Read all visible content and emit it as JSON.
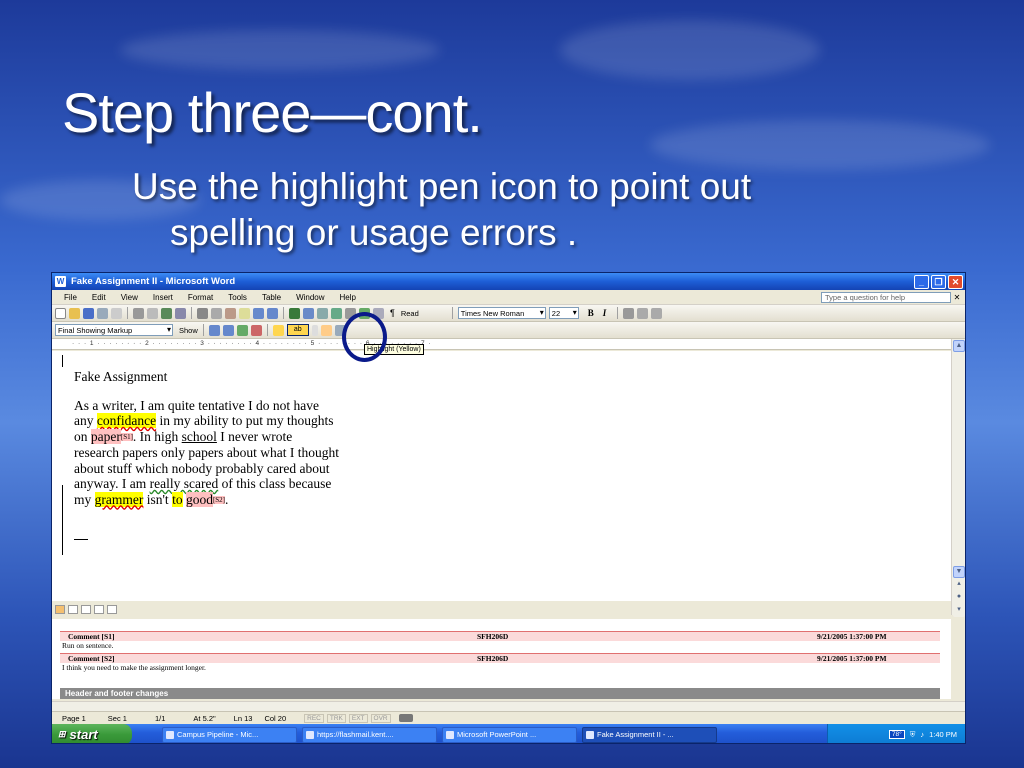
{
  "slide": {
    "title": "Step three—cont.",
    "bullet_line1": "Use the highlight pen icon to point out",
    "bullet_line2": "spelling or usage errors ."
  },
  "window": {
    "title": "Fake Assignment II - Microsoft Word",
    "menu": [
      "File",
      "Edit",
      "View",
      "Insert",
      "Format",
      "Tools",
      "Table",
      "Window",
      "Help"
    ],
    "help_placeholder": "Type a question for help"
  },
  "toolbar": {
    "read_label": "Read",
    "font": "Times New Roman",
    "font_size": "22"
  },
  "review_toolbar": {
    "markup_mode": "Final Showing Markup",
    "show_label": "Show",
    "highlight_tooltip": "Highlight (Yellow)"
  },
  "ruler": {
    "text": "· · · 1 · · · · · · · · 2 · · · · · · · · 3 · · · · · · · · 4 · · · · · · · · 5 · · · · · · · · 6 · · · · · · · · 7 ·"
  },
  "document": {
    "title": "Fake Assignment",
    "l1": "As a writer, I am quite tentative I do not have",
    "l2a": "any ",
    "l2_err": "confidance",
    "l2b": " in my ability to put my thoughts",
    "l3a": "on ",
    "l3_cmt": "paper",
    "l3_mark": "[S1]",
    "l3b": ".  In high ",
    "l3_school": "school",
    "l3c": " I never wrote",
    "l4": "research papers only papers about what I thought",
    "l5": "about stuff which nobody probably cared about",
    "l6a": "anyway.  I am ",
    "l6_really": "really scared",
    "l6b": " of this class because",
    "l7a": "my ",
    "l7_err": "grammer",
    "l7b": " isn't ",
    "l7_to": "to",
    "l7c": " ",
    "l7_good": "good",
    "l7_mark": "[S2]",
    "l7d": "."
  },
  "comments": [
    {
      "header": "Comment [S1]",
      "author": "SFH206D",
      "date": "9/21/2005 1:37:00 PM",
      "text": "Run on sentence."
    },
    {
      "header": "Comment [S2]",
      "author": "SFH206D",
      "date": "9/21/2005 1:37:00 PM",
      "text": "I think you need to make the assignment longer."
    }
  ],
  "header_footer_label": "Header and footer changes",
  "status": {
    "page": "Page 1",
    "sec": "Sec 1",
    "pages": "1/1",
    "at": "At 5.2\"",
    "ln": "Ln 13",
    "col": "Col 20",
    "modes": [
      "REC",
      "TRK",
      "EXT",
      "OVR"
    ]
  },
  "taskbar": {
    "start": "start",
    "tasks": [
      "Campus Pipeline - Mic...",
      "https://flashmail.kent....",
      "Microsoft PowerPoint ...",
      "Fake Assignment II - ..."
    ],
    "temp": "78°",
    "clock": "1:40 PM"
  },
  "colors": {
    "highlight": "#ffff00",
    "comment_fill": "#ffc0c0",
    "titlebar": "#1d5ed6",
    "annotation_circle": "#0a1a8a"
  }
}
